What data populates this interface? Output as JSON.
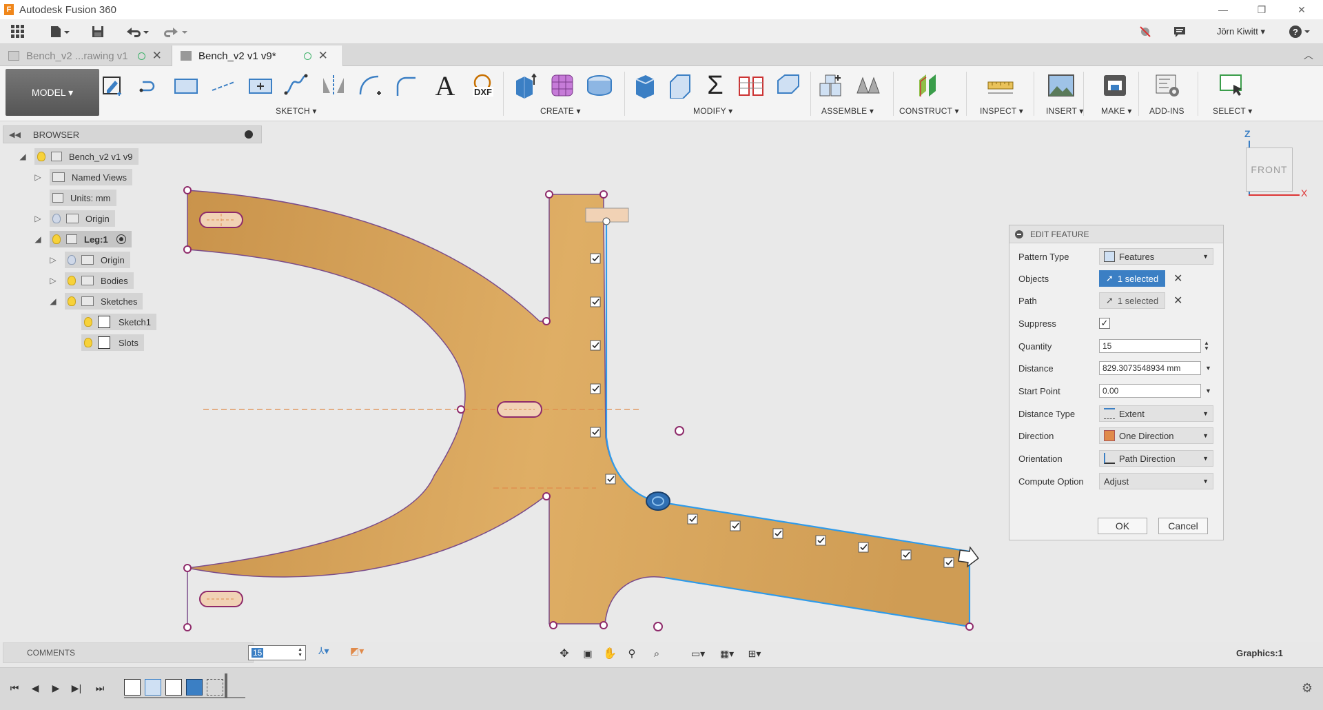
{
  "app": {
    "title": "Autodesk Fusion 360"
  },
  "user": {
    "name": "Jörn Kiwitt ▾"
  },
  "tabs": [
    {
      "label": "Bench_v2 ...rawing v1"
    },
    {
      "label": "Bench_v2 v1 v9*"
    }
  ],
  "ribbon": {
    "workspace": "MODEL ▾",
    "groups": [
      "SKETCH ▾",
      "CREATE ▾",
      "MODIFY ▾",
      "ASSEMBLE ▾",
      "CONSTRUCT ▾",
      "INSPECT ▾",
      "INSERT ▾",
      "MAKE ▾",
      "ADD-INS",
      "SELECT ▾"
    ]
  },
  "browser": {
    "title": "BROWSER",
    "nodes": [
      {
        "label": "Bench_v2 v1 v9"
      },
      {
        "label": "Named Views"
      },
      {
        "label": "Units: mm"
      },
      {
        "label": "Origin"
      },
      {
        "label": "Leg:1"
      },
      {
        "label": "Origin"
      },
      {
        "label": "Bodies"
      },
      {
        "label": "Sketches"
      },
      {
        "label": "Sketch1"
      },
      {
        "label": "Slots"
      }
    ]
  },
  "viewcube": {
    "face": "FRONT",
    "axis_z": "Z",
    "axis_x": "X"
  },
  "edit_feature": {
    "title": "EDIT FEATURE",
    "rows": [
      {
        "label": "Pattern Type",
        "value": "Features"
      },
      {
        "label": "Objects",
        "value": "1 selected"
      },
      {
        "label": "Path",
        "value": "1 selected"
      },
      {
        "label": "Suppress",
        "value": "✓"
      },
      {
        "label": "Quantity",
        "value": "15"
      },
      {
        "label": "Distance",
        "value": "829.3073548934 mm"
      },
      {
        "label": "Start Point",
        "value": "0.00"
      },
      {
        "label": "Distance Type",
        "value": "Extent"
      },
      {
        "label": "Direction",
        "value": "One Direction"
      },
      {
        "label": "Orientation",
        "value": "Path Direction"
      },
      {
        "label": "Compute Option",
        "value": "Adjust"
      }
    ],
    "ok": "OK",
    "cancel": "Cancel"
  },
  "bottom": {
    "comments": "COMMENTS",
    "quantity_value": "15",
    "graphics": "Graphics:1"
  },
  "colors": {
    "accent": "#3b7fc4",
    "wood": "#d9a95e",
    "sketch_points": "#8e2a6a"
  }
}
